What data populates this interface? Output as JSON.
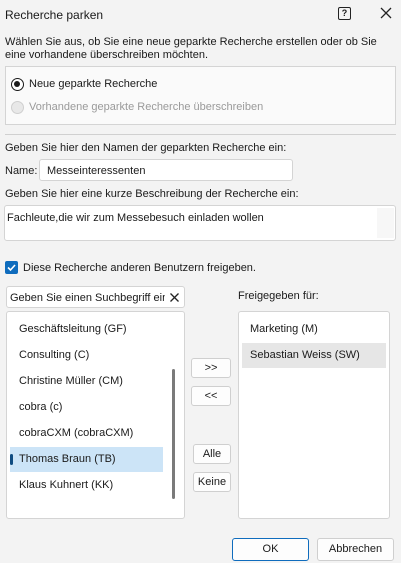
{
  "window": {
    "title": "Recherche parken",
    "help_glyph": "?"
  },
  "intro_text": "Wählen Sie aus, ob Sie eine neue geparkte Recherche erstellen oder ob Sie eine vorhandene überschreiben möchten.",
  "options": {
    "new_label": "Neue geparkte Recherche",
    "overwrite_label": "Vorhandene geparkte Recherche überschreiben",
    "selected": "new"
  },
  "name_section": {
    "heading": "Geben Sie hier den Namen der geparkten Recherche ein:",
    "label": "Name:",
    "value": "Messeinteressenten"
  },
  "description_section": {
    "heading": "Geben Sie hier eine kurze Beschreibung der Recherche ein:",
    "value": "Fachleute,die wir zum Messebesuch einladen wollen"
  },
  "share": {
    "label": "Diese Recherche anderen Benutzern freigeben.",
    "checked": true
  },
  "search": {
    "placeholder": "Geben Sie einen Suchbegriff ein"
  },
  "available_users": [
    "Geschäftsleitung (GF)",
    "Consulting (C)",
    "Christine Müller (CM)",
    "cobra (c)",
    "cobraCXM (cobraCXM)",
    "Thomas Braun (TB)",
    "Klaus Kuhnert (KK)"
  ],
  "available_selected_index": 5,
  "released_heading": "Freigegeben für:",
  "released_users": [
    "Marketing (M)",
    "Sebastian Weiss (SW)"
  ],
  "released_selected_index": 1,
  "transfer_buttons": {
    "add": ">>",
    "remove": "<<",
    "all": "Alle",
    "none": "Keine"
  },
  "footer": {
    "ok": "OK",
    "cancel": "Abbrechen"
  },
  "colors": {
    "accent": "#0f6cbd",
    "selection": "#cce4f7"
  }
}
